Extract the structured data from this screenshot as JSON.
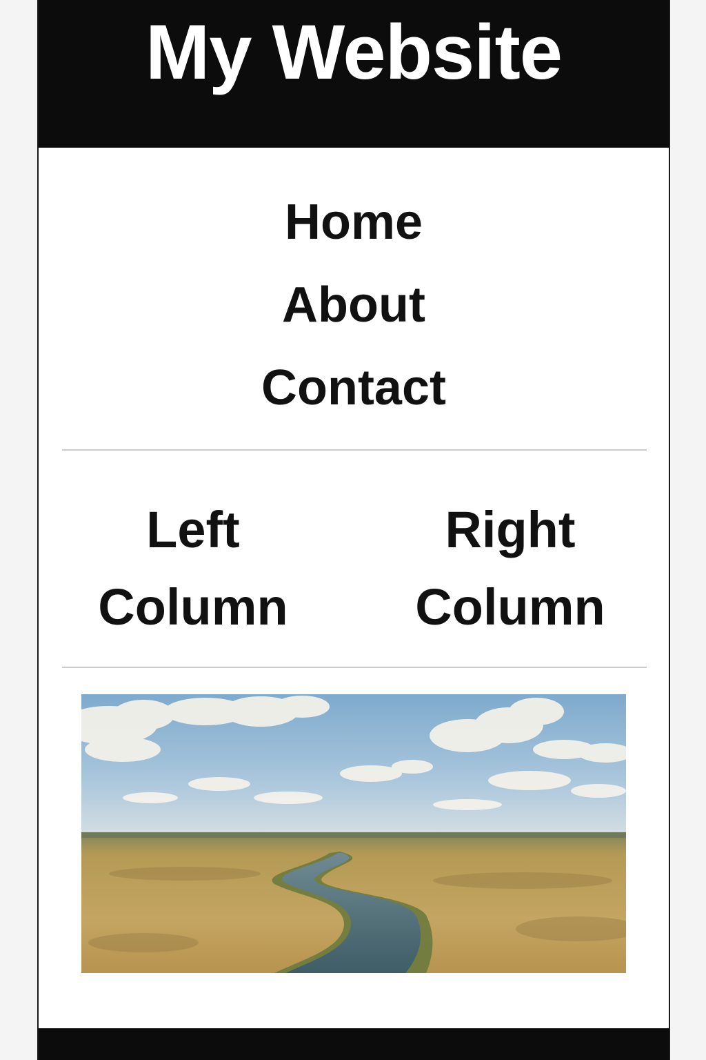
{
  "header": {
    "title": "My Website",
    "background": "#0c0c0c",
    "text_color": "#ffffff"
  },
  "nav": {
    "items": [
      {
        "label": "Home"
      },
      {
        "label": "About"
      },
      {
        "label": "Contact"
      }
    ]
  },
  "columns": {
    "left": "Left Column",
    "right": "Right Column"
  },
  "hero_image": {
    "icon": "landscape-river-photo",
    "colors": {
      "sky": "#8fb6d4",
      "field": "#b99a52",
      "river": "#4d6c75"
    }
  },
  "footer": {
    "background": "#0c0c0c"
  }
}
